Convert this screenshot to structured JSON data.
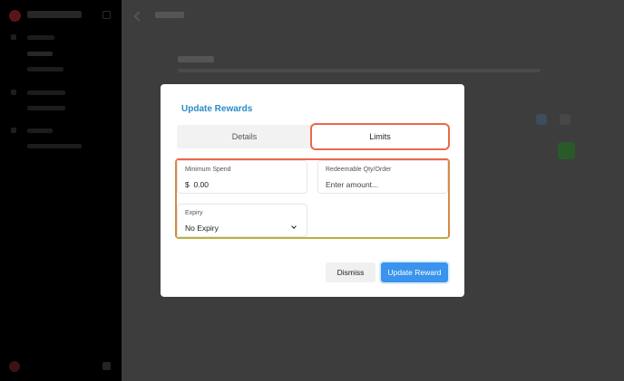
{
  "modal": {
    "title": "Update Rewards",
    "tabs": [
      {
        "label": "Details",
        "active": false
      },
      {
        "label": "Limits",
        "active": true
      }
    ],
    "fields": {
      "minimum_spend": {
        "label": "Minimum Spend",
        "currency": "$",
        "value": "0.00"
      },
      "redeemable": {
        "label": "Redeemable Qty/Order",
        "placeholder": "Enter amount..."
      },
      "expiry": {
        "label": "Expiry",
        "value": "No Expiry"
      }
    },
    "buttons": {
      "dismiss": "Dismiss",
      "update": "Update Reward"
    }
  },
  "colors": {
    "accent": "#2a8ac6",
    "primary_button": "#3a93ec",
    "highlight": "#e8694a",
    "overlay": "#3d3d3d"
  }
}
